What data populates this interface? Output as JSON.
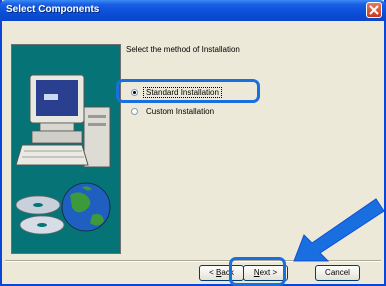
{
  "window": {
    "title": "Select Components"
  },
  "prompt": "Select the method of Installation",
  "options": [
    {
      "label": "Standard Installation",
      "selected": true
    },
    {
      "label": "Custom Installation",
      "selected": false
    }
  ],
  "buttons": {
    "back_mnemonic": "B",
    "back_rest": "ack",
    "back_prefix": "< ",
    "next_mnemonic": "N",
    "next_rest": "ext",
    "next_suffix": " >",
    "cancel": "Cancel"
  },
  "colors": {
    "titlebar": "#0b4ed8",
    "annotation": "#1a6fe0",
    "image_panel": "#067477"
  },
  "icons": [
    "computer-icon",
    "cd-icon",
    "globe-icon",
    "close-icon",
    "pointer-arrow"
  ]
}
